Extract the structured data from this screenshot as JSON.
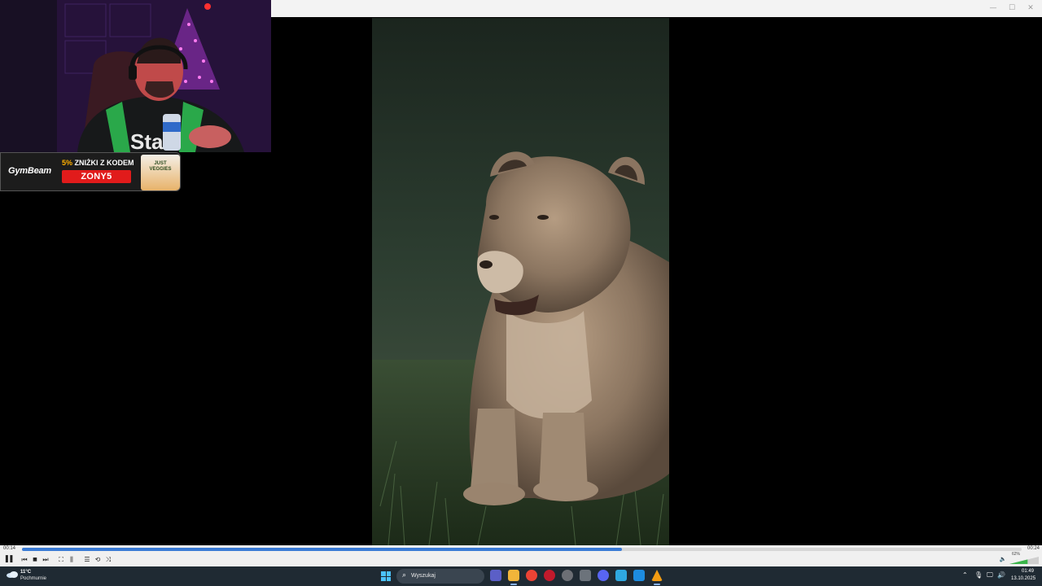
{
  "window": {
    "controls": [
      "minimize-icon",
      "maximize-icon",
      "close-icon"
    ],
    "minimize_glyph": "—",
    "maximize_glyph": "☐",
    "close_glyph": "✕"
  },
  "webcam": {
    "jersey_text": "Sta"
  },
  "sponsor": {
    "brand": "GymBeam",
    "promo_percent": "5%",
    "promo_text": " ZNIŻKI Z KODEM",
    "code": "ZONY5",
    "pack_text": "JUST VEGGIES"
  },
  "player": {
    "elapsed": "00:14",
    "duration": "00:24",
    "progress_fraction": 0.6,
    "volume_percent": "62%",
    "volume_fraction": 0.62,
    "buttons": [
      {
        "name": "pause-icon",
        "glyph": "❚❚"
      },
      {
        "name": "previous-icon",
        "glyph": "⏮"
      },
      {
        "name": "stop-icon",
        "glyph": "■"
      },
      {
        "name": "next-icon",
        "glyph": "⏭"
      },
      {
        "name": "fullscreen-icon",
        "glyph": "⛶"
      },
      {
        "name": "extended-settings-icon",
        "glyph": "⫼"
      },
      {
        "name": "playlist-icon",
        "glyph": "☰"
      },
      {
        "name": "loop-icon",
        "glyph": "⟲"
      },
      {
        "name": "shuffle-icon",
        "glyph": "⤨"
      }
    ],
    "speaker_glyph": "🔈"
  },
  "taskbar": {
    "weather_temp": "11°C",
    "weather_desc": "Pochmurnie",
    "search_placeholder": "Wyszukaj",
    "search_glyph": "⌕",
    "apps": [
      {
        "name": "teams-icon",
        "color": "#5b5fc7"
      },
      {
        "name": "file-explorer-icon",
        "color": "#f2b53a"
      },
      {
        "name": "chrome-icon",
        "color": "#ea4335"
      },
      {
        "name": "opera-icon",
        "color": "#c21a2c"
      },
      {
        "name": "browser-icon",
        "color": "#6c6f75"
      },
      {
        "name": "mail-icon",
        "color": "#6c737b"
      },
      {
        "name": "discord-icon",
        "color": "#5865f2"
      },
      {
        "name": "notepad-icon",
        "color": "#2fa8e0"
      },
      {
        "name": "livechat-icon",
        "color": "#1d8ce0"
      },
      {
        "name": "vlc-icon",
        "color": "#f39c12"
      }
    ],
    "tray": {
      "chevron": "⌃",
      "mic": "🎙",
      "network": "🖵",
      "volume": "🔊"
    },
    "clock_time": "01:49",
    "clock_date": "13.10.2025"
  }
}
